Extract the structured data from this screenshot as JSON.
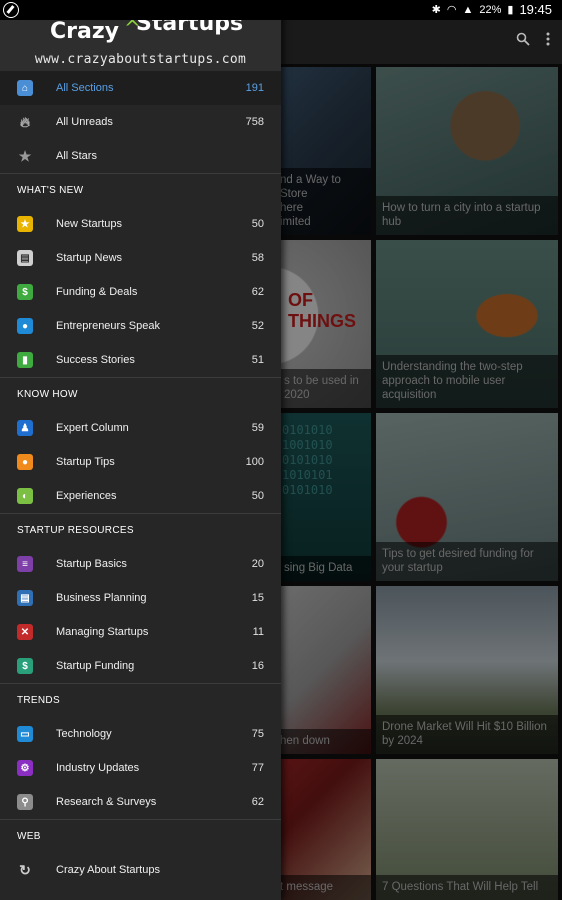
{
  "status_bar": {
    "battery": "22%",
    "time": "19:45"
  },
  "banner": {
    "logo_word1": "Crazy",
    "logo_about": "about",
    "logo_word2": "Startups",
    "tagline": "www.crazyaboutstartups.com"
  },
  "top_items": [
    {
      "label": "All Sections",
      "count": "191",
      "icon": "home-icon",
      "color": "#4a8fd6"
    },
    {
      "label": "All Unreads",
      "count": "758",
      "icon": "flame-icon",
      "color": "#262626"
    },
    {
      "label": "All Stars",
      "count": "",
      "icon": "star-icon",
      "color": "#262626"
    }
  ],
  "sections": [
    {
      "title": "WHAT'S NEW",
      "items": [
        {
          "label": "New Startups",
          "count": "50",
          "icon": "star-badge-icon",
          "color": "#e8b400"
        },
        {
          "label": "Startup News",
          "count": "58",
          "icon": "newspaper-icon",
          "color": "#cfcfcf"
        },
        {
          "label": "Funding & Deals",
          "count": "62",
          "icon": "dollar-icon",
          "color": "#3faa3f"
        },
        {
          "label": "Entrepreneurs Speak",
          "count": "52",
          "icon": "speech-bubble-icon",
          "color": "#1f8ad6"
        },
        {
          "label": "Success Stories",
          "count": "51",
          "icon": "bar-chart-icon",
          "color": "#3faa3f"
        }
      ]
    },
    {
      "title": "KNOW HOW",
      "items": [
        {
          "label": "Expert Column",
          "count": "59",
          "icon": "people-icon",
          "color": "#1f6fd1"
        },
        {
          "label": "Startup Tips",
          "count": "100",
          "icon": "lightbulb-icon",
          "color": "#f08a1c"
        },
        {
          "label": "Experiences",
          "count": "50",
          "icon": "head-icon",
          "color": "#7bc043"
        }
      ]
    },
    {
      "title": "STARTUP RESOURCES",
      "items": [
        {
          "label": "Startup Basics",
          "count": "20",
          "icon": "layers-icon",
          "color": "#7e3fa8"
        },
        {
          "label": "Business Planning",
          "count": "15",
          "icon": "document-icon",
          "color": "#2f6fb5"
        },
        {
          "label": "Managing Startups",
          "count": "11",
          "icon": "tools-icon",
          "color": "#c32b2b"
        },
        {
          "label": "Startup Funding",
          "count": "16",
          "icon": "dollar-icon",
          "color": "#2aa07a"
        }
      ]
    },
    {
      "title": "TRENDS",
      "items": [
        {
          "label": "Technology",
          "count": "75",
          "icon": "monitor-icon",
          "color": "#1f8ad6"
        },
        {
          "label": "Industry Updates",
          "count": "77",
          "icon": "gear-icon",
          "color": "#8a2fc2"
        },
        {
          "label": "Research & Surveys",
          "count": "62",
          "icon": "magnifier-icon",
          "color": "#8c8c8c"
        }
      ]
    },
    {
      "title": "WEB",
      "items": [
        {
          "label": "Crazy About Startups",
          "count": "",
          "icon": "refresh-icon",
          "color": "#262626"
        }
      ]
    }
  ],
  "tiles": [
    {
      "caption": "nd a Way to Store\nhere\nimited"
    },
    {
      "caption": "How to turn a city into a startup\nhub"
    },
    {
      "caption": "s to be used in\n2020"
    },
    {
      "caption": "Understanding the two-step\napproach to mobile user\nacquisition"
    },
    {
      "caption": "sing Big Data"
    },
    {
      "caption": "Tips to get desired funding for\nyour startup"
    },
    {
      "caption": "hen down"
    },
    {
      "caption": "Drone Market Will Hit $10 Billion\nby 2024"
    },
    {
      "caption": "t message"
    },
    {
      "caption": "7 Questions That Will Help Tell"
    }
  ],
  "colors": {
    "accent": "#5aa0e6",
    "drawer_bg": "#262626"
  }
}
